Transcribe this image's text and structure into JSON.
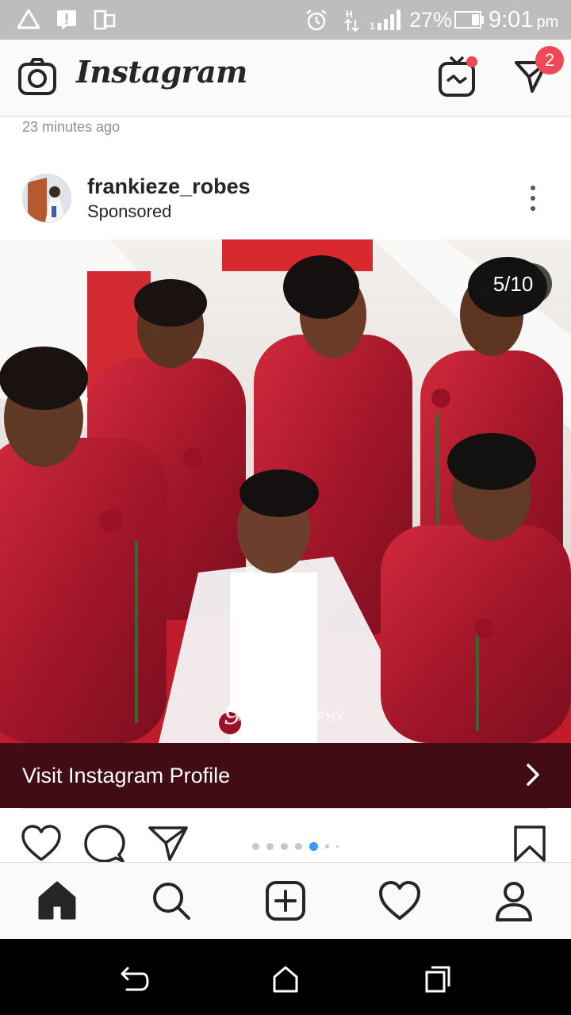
{
  "status_bar": {
    "battery": "27%",
    "time": "9:01",
    "ampm": "pm",
    "icons": [
      "warning-triangle-icon",
      "alert-message-icon",
      "dual-screen-icon",
      "alarm-clock-icon",
      "data-arrows-icon",
      "signal-icon",
      "battery-icon"
    ]
  },
  "header": {
    "title": "Instagram",
    "igtv_icon": "igtv-icon",
    "direct_badge": "2",
    "colors": {
      "badge": "#ed4956"
    }
  },
  "feed": {
    "previous_post_time": "23 minutes ago",
    "post": {
      "username": "frankieze_robes",
      "subtitle": "Sponsored",
      "carousel_counter": "5/10",
      "watermark": "glintz",
      "watermark_sub": "PHOTOGRAPHY",
      "cta_label": "Visit Instagram Profile",
      "carousel_dots_total": 7,
      "carousel_dots_active": 5,
      "colors": {
        "cta_background": "#410c13",
        "active_dot": "#3897f0"
      }
    }
  },
  "tab_bar": {
    "tabs": [
      "home-icon",
      "search-icon",
      "new-post-icon",
      "activity-heart-icon",
      "profile-icon"
    ]
  },
  "android_nav": [
    "back-icon",
    "home-icon",
    "recents-icon"
  ]
}
